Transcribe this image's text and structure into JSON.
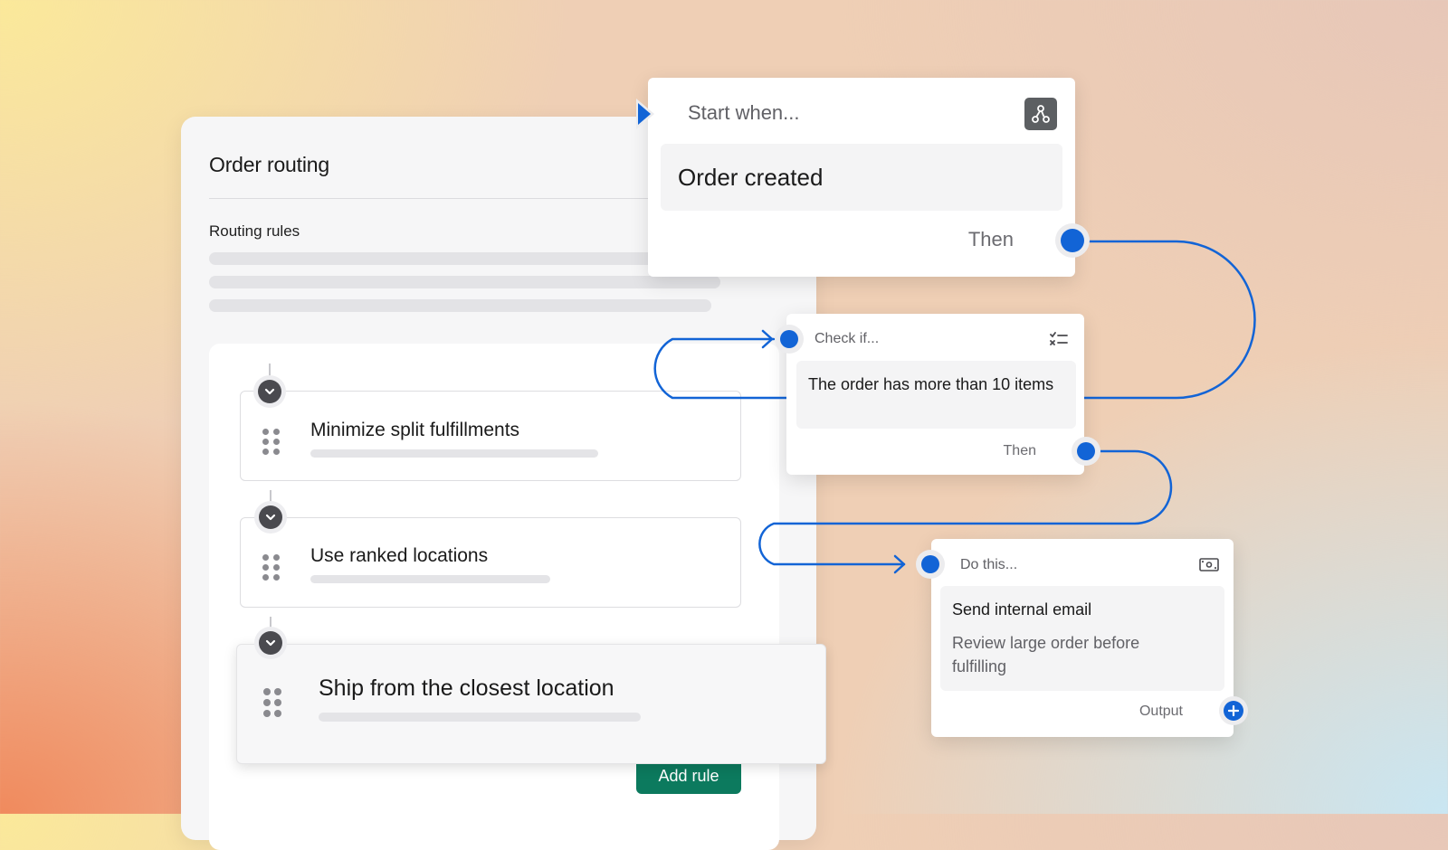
{
  "panel": {
    "title": "Order routing",
    "section_label": "Routing rules",
    "rules": [
      {
        "label": "Minimize split fulfillments"
      },
      {
        "label": "Use ranked locations"
      },
      {
        "label": "Ship from the closest location"
      }
    ],
    "add_rule_label": "Add rule"
  },
  "start_card": {
    "header": "Start when...",
    "trigger": "Order created",
    "then_label": "Then",
    "icon": "workflow-icon"
  },
  "check_card": {
    "header": "Check if...",
    "condition": "The order has more than 10 items",
    "then_label": "Then",
    "icon": "checklist-icon"
  },
  "action_card": {
    "header": "Do this...",
    "action_title": "Send internal email",
    "action_detail": "Review large order before fulfilling",
    "output_label": "Output",
    "icon": "money-icon"
  },
  "colors": {
    "accent_blue": "#1264d6",
    "button_green": "#0c7a5e"
  }
}
